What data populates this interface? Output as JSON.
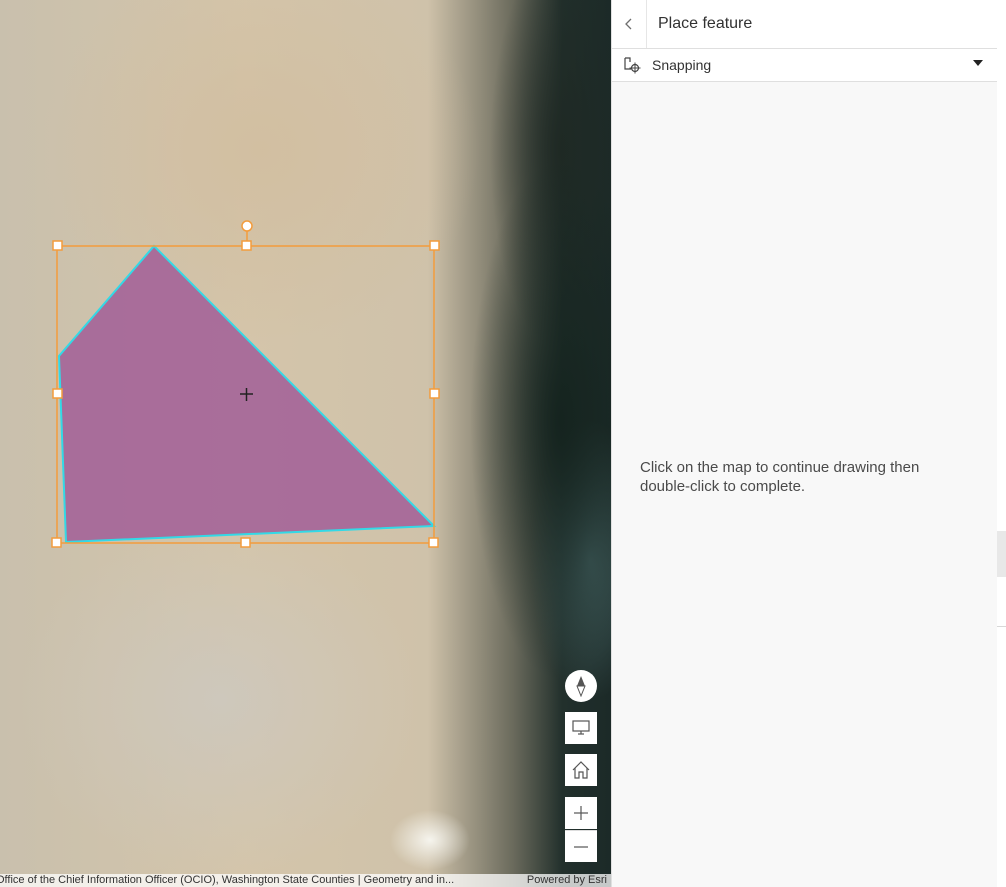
{
  "panel": {
    "title": "Place feature",
    "snapping_label": "Snapping",
    "hint": "Click on the map to continue drawing then double-click to complete."
  },
  "map": {
    "attribution": "Office of the Chief Information Officer (OCIO), Washington State Counties | Geometry and in...",
    "powered_by": "Powered by Esri"
  },
  "colors": {
    "polygon_fill": "#a05a96",
    "polygon_outline": "#33d9e6",
    "selection_box": "#f39c3c"
  },
  "icons": {
    "back": "chevron-left-icon",
    "snapping": "snapping-icon",
    "caret": "caret-down-icon",
    "compass": "compass-icon",
    "screen": "monitor-icon",
    "home": "home-icon",
    "zoom_in": "plus-icon",
    "zoom_out": "minus-icon"
  }
}
